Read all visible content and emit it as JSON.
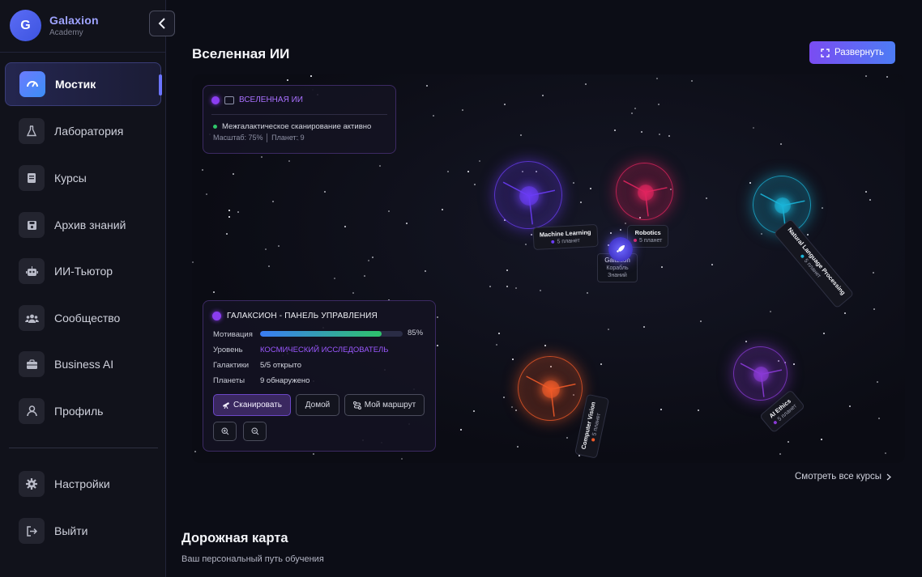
{
  "brand": {
    "initial": "G",
    "name": "Galaxion",
    "subtitle": "Academy"
  },
  "sidebar": {
    "items": [
      {
        "label": "Мостик",
        "icon": "dashboard-icon",
        "active": true
      },
      {
        "label": "Лаборатория",
        "icon": "flask-icon"
      },
      {
        "label": "Курсы",
        "icon": "book-icon"
      },
      {
        "label": "Архив знаний",
        "icon": "save-icon"
      },
      {
        "label": "ИИ-Тьютор",
        "icon": "robot-icon"
      },
      {
        "label": "Сообщество",
        "icon": "users-icon"
      },
      {
        "label": "Business AI",
        "icon": "briefcase-icon"
      },
      {
        "label": "Профиль",
        "icon": "user-icon"
      }
    ],
    "bottom": [
      {
        "label": "Настройки",
        "icon": "gear-icon"
      },
      {
        "label": "Выйти",
        "icon": "logout-icon"
      }
    ]
  },
  "universe": {
    "title": "Вселенная ИИ",
    "expand_label": "Развернуть",
    "info_panel": {
      "title": "ВСЕЛЕННАЯ ИИ",
      "status": "Межгалактическое сканирование активно",
      "scale": "Масштаб: 75% │ Планет: 9"
    },
    "control_panel": {
      "title": "ГАЛАКСИОН - ПАНЕЛЬ УПРАВЛЕНИЯ",
      "motivation_label": "Мотивация",
      "motivation_value": 0.85,
      "motivation_text": "85%",
      "level_label": "Уровень",
      "level_value": "КОСМИЧЕСКИЙ ИССЛЕДОВАТЕЛЬ",
      "galaxies_label": "Галактики",
      "galaxies_value": "5/5 открыто",
      "planets_label": "Планеты",
      "planets_value": "9 обнаружено",
      "scan_button": "Сканировать",
      "home_button": "Домой",
      "route_button": "Мой маршрут",
      "zoom_in": "+",
      "zoom_out": "−"
    },
    "planets": [
      {
        "name": "Machine Learning",
        "count": "5 планет",
        "color": "#6a3cf5"
      },
      {
        "name": "Robotics",
        "count": "5 планет",
        "color": "#e0245e"
      },
      {
        "name": "Natural Language Processing",
        "count": "5 планет",
        "color": "#1ab4d8"
      },
      {
        "name": "Computer Vision",
        "count": "5 планет",
        "color": "#f05a28"
      },
      {
        "name": "AI Ethics",
        "count": "5 планет",
        "color": "#8a3ad6"
      }
    ],
    "ship": {
      "name": "Galaxion",
      "subtitle": "Корабль Знаний"
    },
    "view_all": "Смотреть все курсы"
  },
  "roadmap": {
    "title": "Дорожная карта",
    "subtitle": "Ваш персональный путь обучения"
  }
}
